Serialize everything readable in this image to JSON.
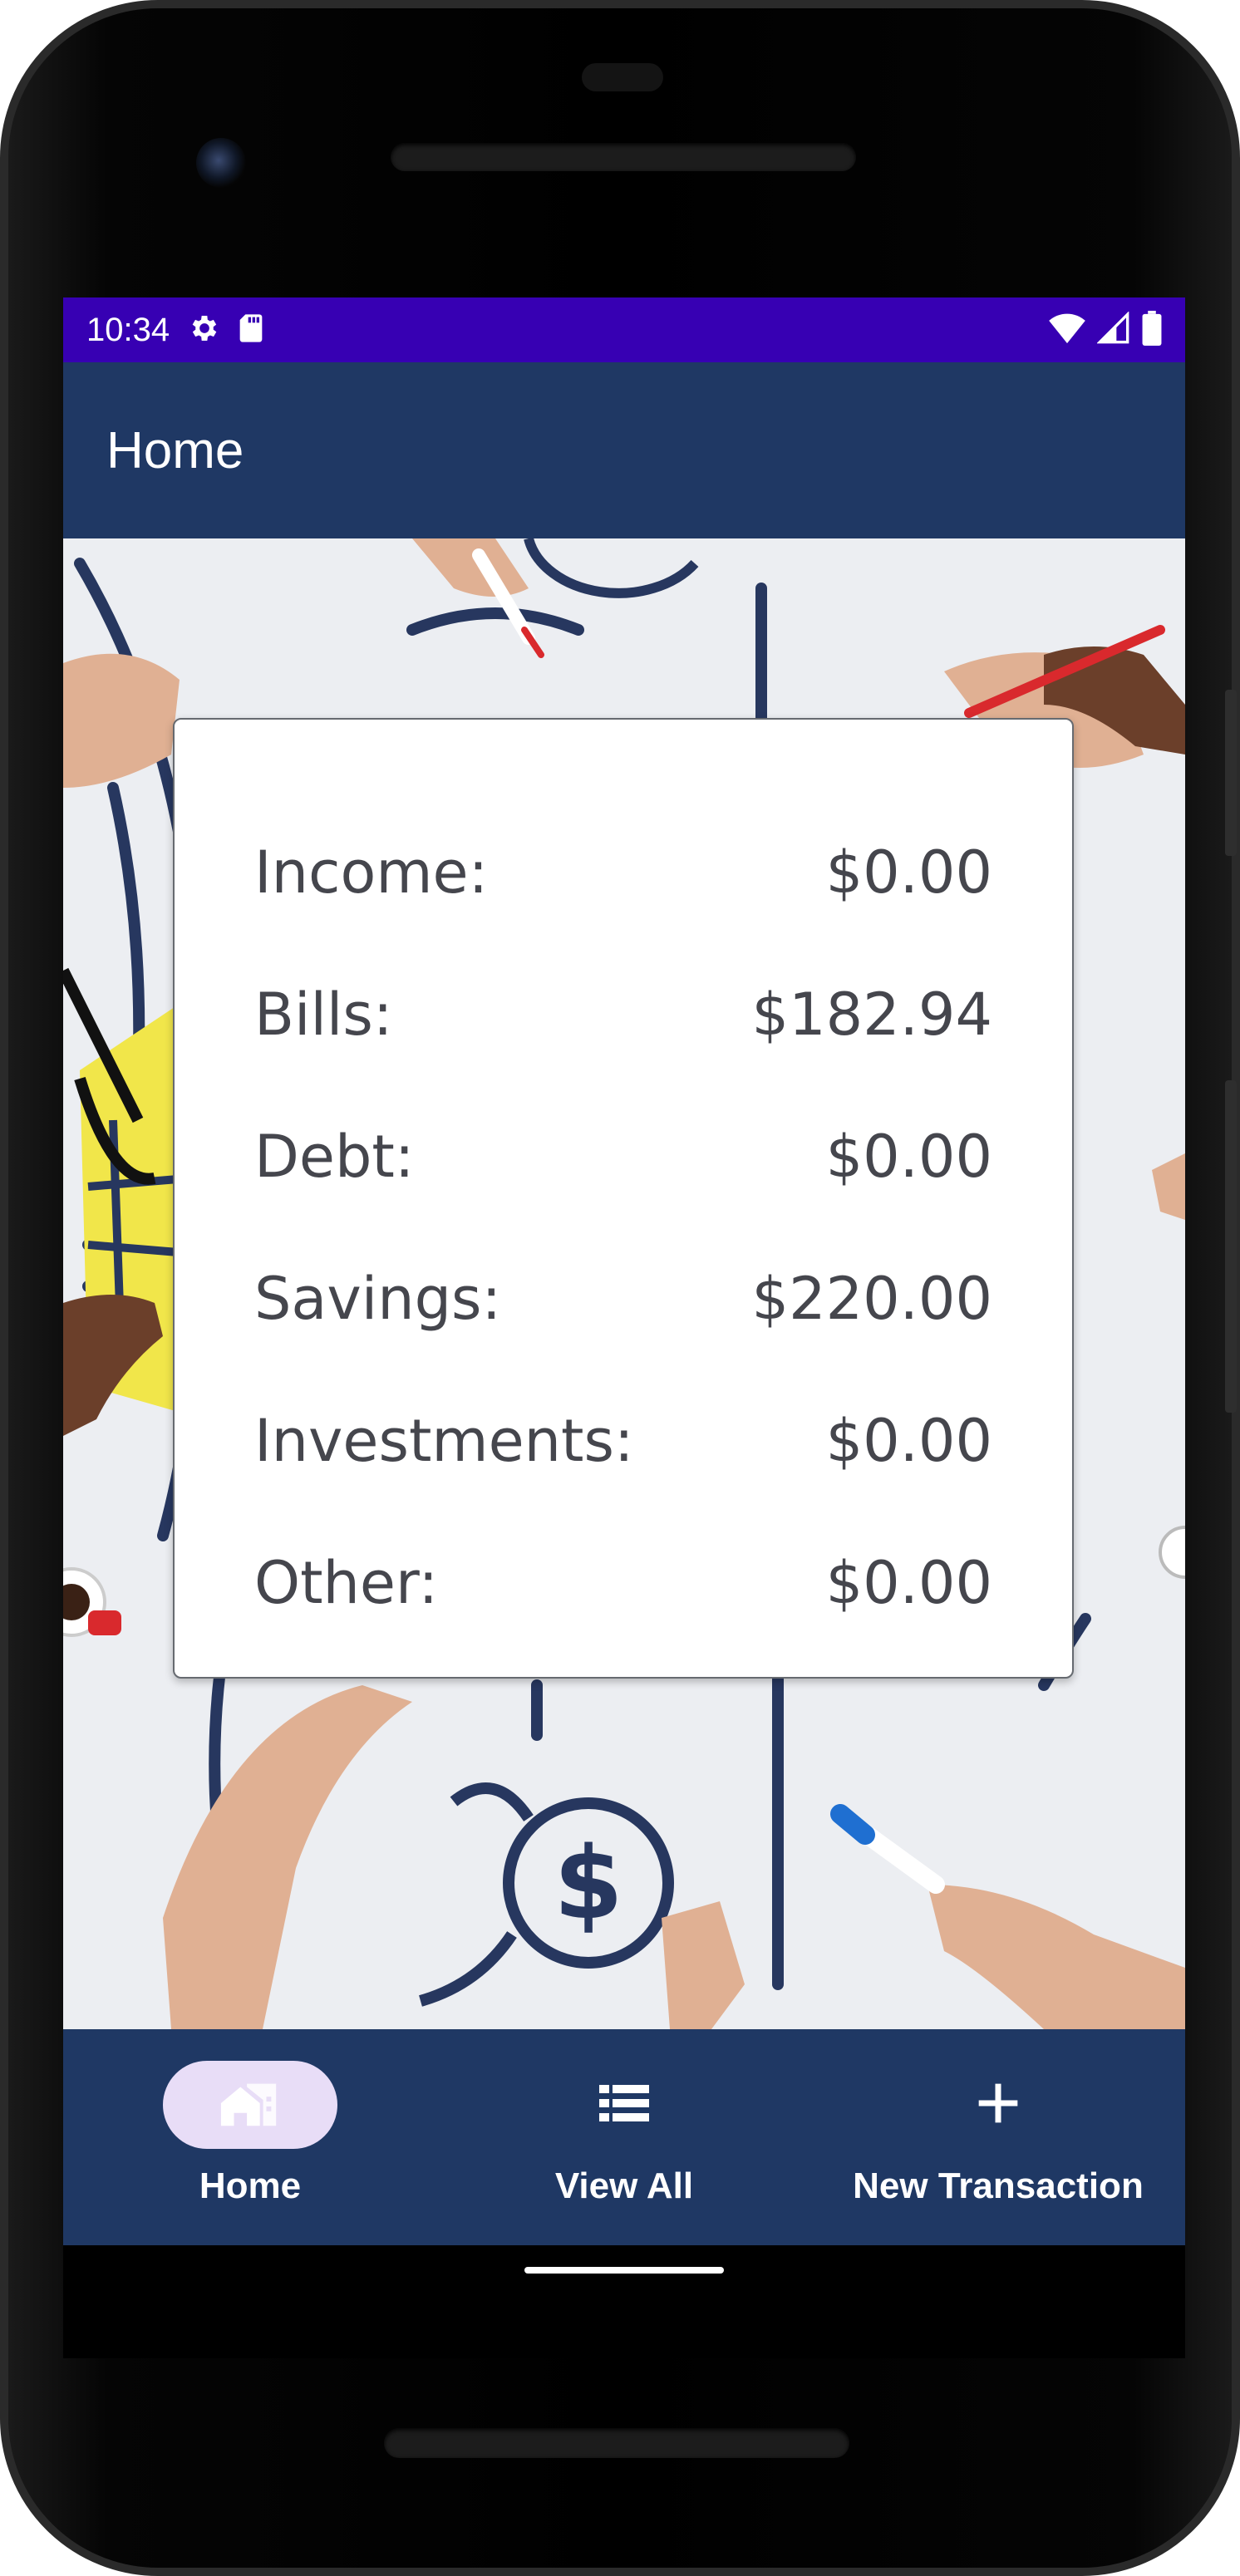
{
  "status_bar": {
    "time": "10:34",
    "icons_left": [
      "gear-icon",
      "sd-card-icon"
    ],
    "icons_right": [
      "wifi-icon",
      "cell-signal-icon",
      "battery-icon"
    ],
    "color": "#3700b3"
  },
  "app_bar": {
    "title": "Home",
    "color": "#1f3864"
  },
  "summary": {
    "rows": [
      {
        "label": "Income:",
        "value": "$0.00"
      },
      {
        "label": "Bills:",
        "value": "$182.94"
      },
      {
        "label": "Debt:",
        "value": "$0.00"
      },
      {
        "label": "Savings:",
        "value": "$220.00"
      },
      {
        "label": "Investments:",
        "value": "$0.00"
      },
      {
        "label": "Other:",
        "value": "$0.00"
      }
    ]
  },
  "bottom_nav": {
    "items": [
      {
        "label": "Home",
        "icon": "home-icon",
        "active": true
      },
      {
        "label": "View All",
        "icon": "list-icon",
        "active": false
      },
      {
        "label": "New Transaction",
        "icon": "plus-icon",
        "active": false
      }
    ],
    "color": "#1f3864",
    "active_indicator_color": "#e8ddf7"
  }
}
